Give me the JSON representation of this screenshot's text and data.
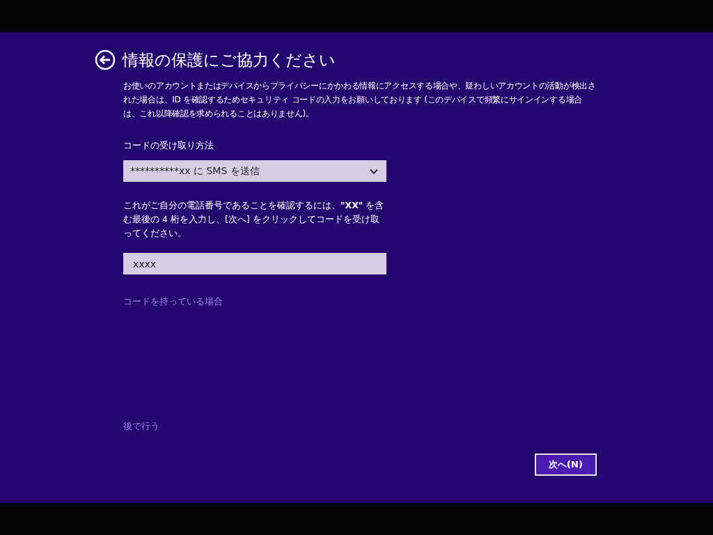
{
  "header": {
    "title": "情報の保護にご協力ください",
    "description": "お使いのアカウントまたはデバイスからプライバシーにかかわる情報にアクセスする場合や、疑わしいアカウントの活動が検出された場合は、ID を確認するためセキュリティ コードの入力をお願いしております (このデバイスで頻繁にサインインする場合は、これ以降確認を求められることはありません)。"
  },
  "method": {
    "label": "コードの受け取り方法",
    "value": "**********xx に SMS を送信"
  },
  "instruction": "これがご自分の電話番号であることを確認するには、**\"XX\"** を含む最後の 4 桁を入力し、[次へ] をクリックしてコードを受け取ってください。",
  "digits_field": {
    "value": "xxxx"
  },
  "have_code_link": "コードを持っている場合",
  "later_link": "後で行う",
  "next_button": "次へ(N)"
}
